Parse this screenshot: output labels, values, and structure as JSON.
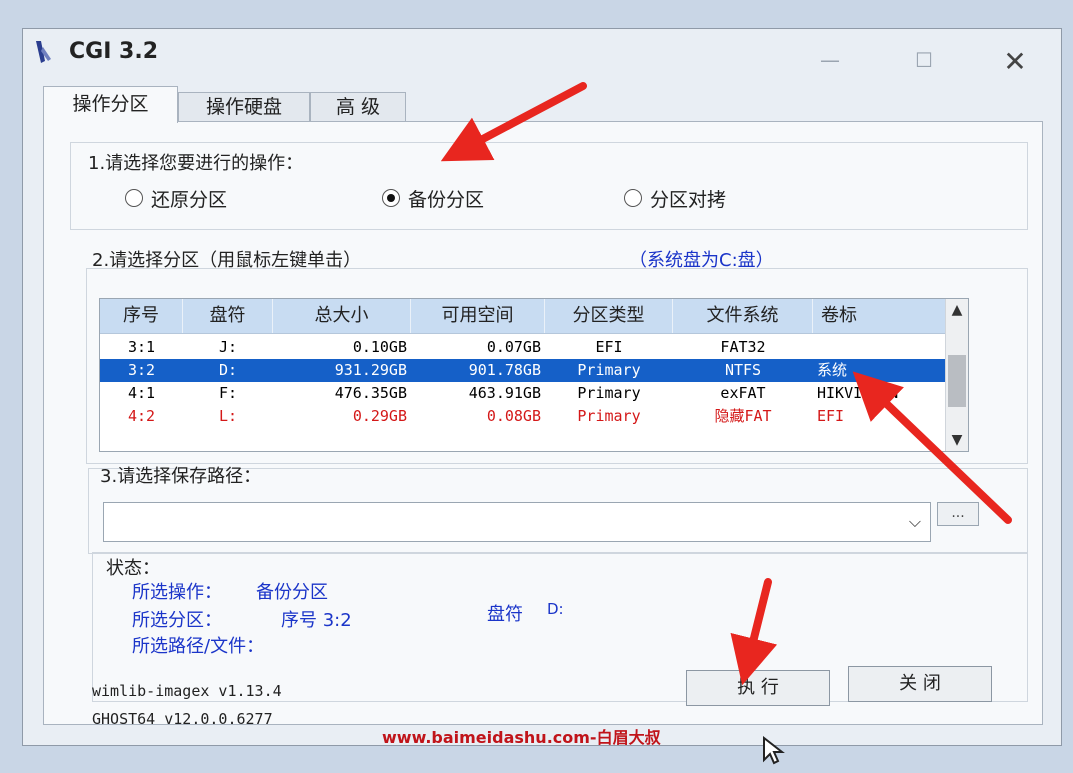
{
  "window": {
    "title": "CGI 3.2"
  },
  "tabs": [
    {
      "label": "操作分区",
      "active": true
    },
    {
      "label": "操作硬盘",
      "active": false
    },
    {
      "label": "高 级",
      "active": false
    }
  ],
  "operation": {
    "prompt": "1.请选择您要进行的操作：",
    "options": [
      {
        "label": "还原分区",
        "selected": false
      },
      {
        "label": "备份分区",
        "selected": true
      },
      {
        "label": "分区对拷",
        "selected": false
      }
    ]
  },
  "partition": {
    "prompt": "2.请选择分区（用鼠标左键单击）",
    "note": "（系统盘为C:盘）",
    "columns": [
      "序号",
      "盘符",
      "总大小",
      "可用空间",
      "分区类型",
      "文件系统",
      "卷标"
    ],
    "rows": [
      {
        "cells": [
          "3:1",
          "J:",
          "0.10GB",
          "0.07GB",
          "EFI",
          "FAT32",
          ""
        ],
        "state": "normal"
      },
      {
        "cells": [
          "3:2",
          "D:",
          "931.29GB",
          "901.78GB",
          "Primary",
          "NTFS",
          "系统"
        ],
        "state": "selected"
      },
      {
        "cells": [
          "4:1",
          "F:",
          "476.35GB",
          "463.91GB",
          "Primary",
          "exFAT",
          "HIKVISION"
        ],
        "state": "normal"
      },
      {
        "cells": [
          "4:2",
          "L:",
          "0.29GB",
          "0.08GB",
          "Primary",
          "隐藏FAT",
          "EFI"
        ],
        "state": "hidden"
      }
    ]
  },
  "save_path": {
    "prompt": "3.请选择保存路径：",
    "value": "",
    "browse_label": "..."
  },
  "status": {
    "title": "状态：",
    "operation_label": "所选操作：",
    "operation_value": "备份分区",
    "partition_label": "所选分区：",
    "partition_value": "序号 3:2",
    "drive_label": "盘符",
    "drive_value": "D:",
    "path_label": "所选路径/文件：",
    "path_value": ""
  },
  "versions": {
    "wimlib": "wimlib-imagex v1.13.4",
    "ghost": "GHOST64 v12.0.0.6277"
  },
  "buttons": {
    "execute": "执 行",
    "close": "关 闭"
  },
  "watermark": "www.baimeidashu.com-白眉大叔",
  "colors": {
    "selection": "#1560c8",
    "accent_blue": "#1b35c9",
    "hidden_red": "#d41818",
    "arrow_red": "#e8261f"
  }
}
